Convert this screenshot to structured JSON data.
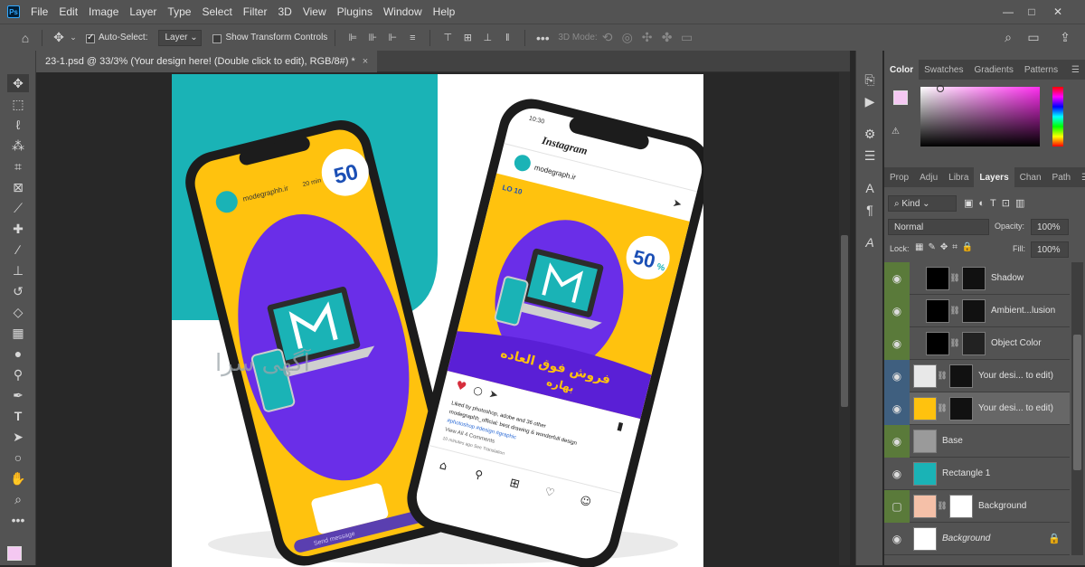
{
  "app_logo": "Ps",
  "menu": [
    "File",
    "Edit",
    "Image",
    "Layer",
    "Type",
    "Select",
    "Filter",
    "3D",
    "View",
    "Plugins",
    "Window",
    "Help"
  ],
  "window_controls": {
    "minimize": "—",
    "restore": "□",
    "close": "✕"
  },
  "options": {
    "auto_select_label": "Auto-Select:",
    "auto_select_value": "Layer",
    "transform_controls_label": "Show Transform Controls",
    "mode_3d_label": "3D Mode:"
  },
  "doc_tab": {
    "title": "23-1.psd @ 33/3% (Your design here! (Double click to edit), RGB/8#) *",
    "close": "×"
  },
  "canvas": {
    "watermark": "آگهی سرا",
    "phone_left": {
      "brand": "modegraphh.ir",
      "time_ago": "20 min",
      "badge_number": "50",
      "message_placeholder": "Send message"
    },
    "phone_right": {
      "time": "10:30",
      "app_name": "Instagram",
      "account": "modegraph.ir",
      "logo_text": "LO  10",
      "badge_number": "50",
      "badge_percent": "%",
      "headline_fa": "فروش فوق العاده",
      "headline_fa_2": "بهاره",
      "caption": [
        "Liked by photoshop, adobe and 36 other",
        "modegraphh_official: best drawing & wonderfull design",
        "#photoshop #design #graphic",
        "View All 4 Comments",
        "10 minutes ago  See Translation"
      ]
    },
    "colors": {
      "teal": "#1ab3b6",
      "yellow": "#ffc20e",
      "purple": "#6a2ee8",
      "phone": "#1c1c1c"
    }
  },
  "panels": {
    "color_tabs": [
      "Color",
      "Swatches",
      "Gradients",
      "Patterns"
    ],
    "layer_tabs": [
      "Prop",
      "Adju",
      "Libra",
      "Layers",
      "Chan",
      "Path"
    ],
    "kind_label": "Kind",
    "blend_mode": "Normal",
    "opacity_label": "Opacity:",
    "opacity_value": "100%",
    "lock_label": "Lock:",
    "fill_label": "Fill:",
    "fill_value": "100%",
    "foreground_color": "#f4c8f2",
    "layers": [
      {
        "name": "Shadow",
        "eye_style": "green"
      },
      {
        "name": "Ambient...lusion",
        "eye_style": "green"
      },
      {
        "name": "Object Color",
        "eye_style": "green"
      },
      {
        "name": "Your desi... to edit)",
        "eye_style": "blue"
      },
      {
        "name": "Your desi... to edit)",
        "eye_style": "blue",
        "selected": true
      },
      {
        "name": "Base",
        "eye_style": "green"
      },
      {
        "name": "Rectangle 1",
        "eye_style": "none"
      },
      {
        "name": "Background",
        "eye_style": "green"
      },
      {
        "name": "Background",
        "eye_style": "none",
        "italic": true
      }
    ]
  }
}
